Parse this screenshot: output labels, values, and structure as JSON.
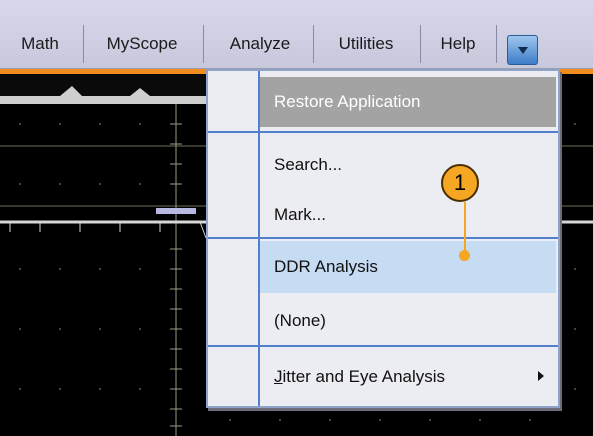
{
  "menubar": {
    "items": [
      "Math",
      "MyScope",
      "Analyze",
      "Utilities",
      "Help"
    ],
    "dropdown_icon": "chevron-down-icon"
  },
  "popup": {
    "items": [
      {
        "label": "Restore Application"
      },
      {
        "label": "Search..."
      },
      {
        "label": "Mark..."
      },
      {
        "label": "DDR Analysis"
      },
      {
        "label": "(None)"
      },
      {
        "label": "Jitter and Eye Analysis",
        "mnemonic": "J",
        "rest": "itter and Eye Analysis"
      }
    ]
  },
  "callout": {
    "number": "1"
  },
  "colors": {
    "accent": "#f28c1e",
    "menu_highlight": "#c5dcf3",
    "restore_bg": "#a3a3a3",
    "callout": "#f5a623"
  }
}
